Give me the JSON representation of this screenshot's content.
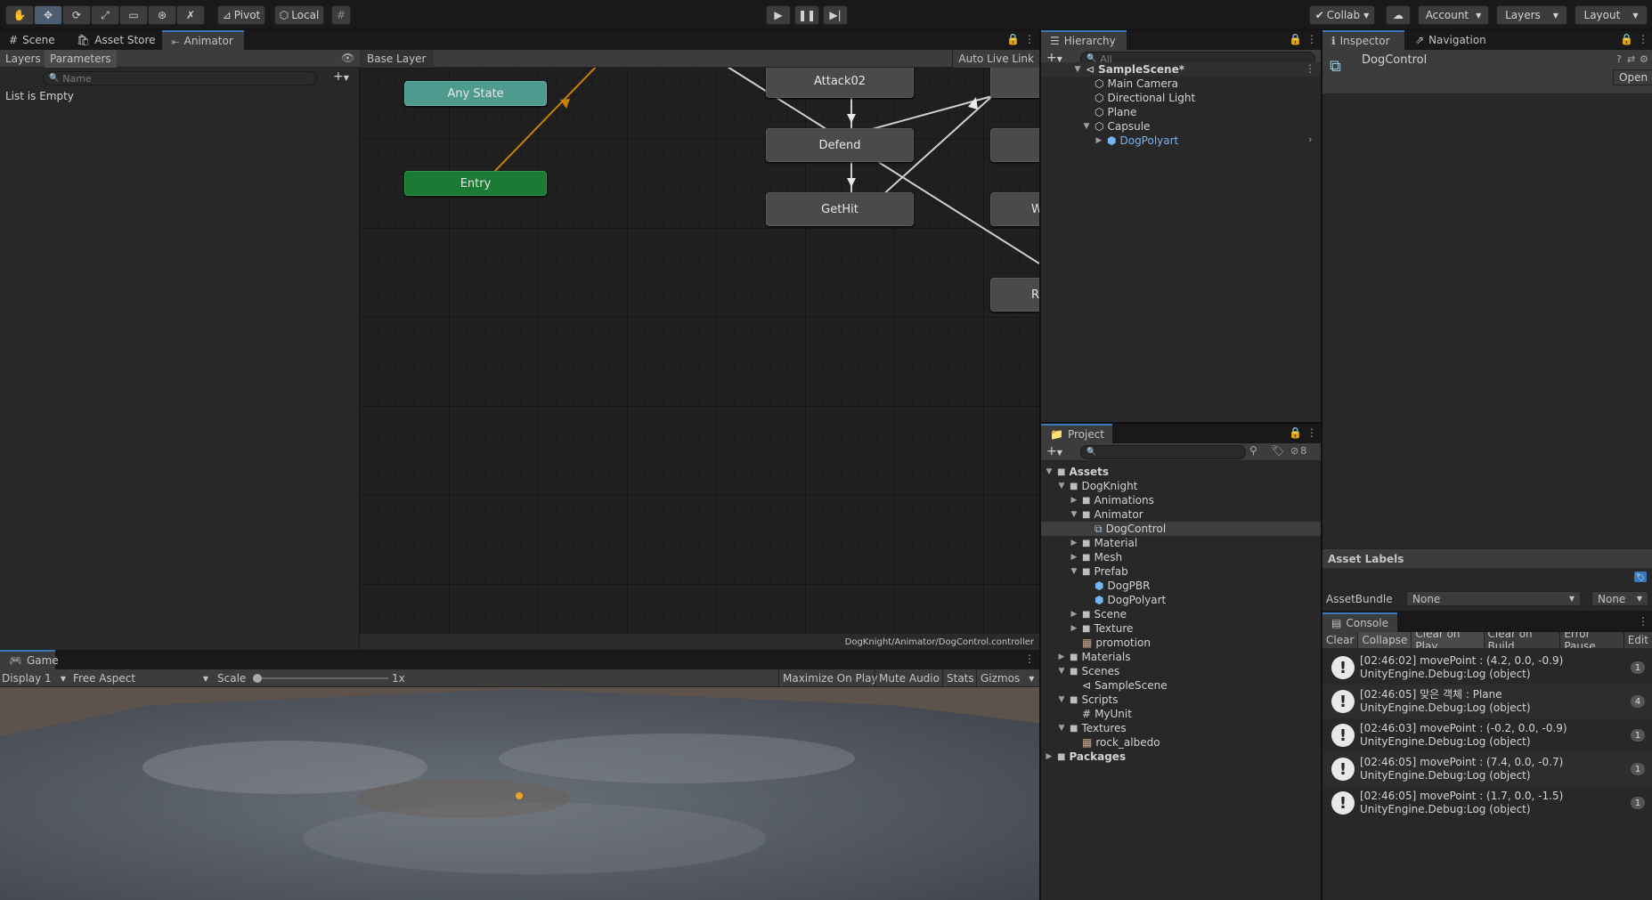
{
  "toolbar": {
    "pivot": "Pivot",
    "local": "Local",
    "collab": "Collab",
    "account": "Account",
    "layers": "Layers",
    "layout": "Layout"
  },
  "scene_tabs": {
    "scene": "Scene",
    "asset_store": "Asset Store",
    "animator": "Animator"
  },
  "animator": {
    "layers_tab": "Layers",
    "parameters_tab": "Parameters",
    "search_placeholder": "Name",
    "list_empty": "List is Empty",
    "base_layer": "Base Layer",
    "auto_live_link": "Auto Live Link",
    "footer_path": "DogKnight/Animator/DogControl.controller",
    "nodes": {
      "any_state": "Any State",
      "entry": "Entry",
      "attack02": "Attack02",
      "defend": "Defend",
      "gethit": "GetHit",
      "partial_w": "W",
      "partial_r": "R"
    }
  },
  "game": {
    "tab": "Game",
    "display": "Display 1",
    "aspect": "Free Aspect",
    "scale_label": "Scale",
    "scale_value": "1x",
    "maximize": "Maximize On Play",
    "mute": "Mute Audio",
    "stats": "Stats",
    "gizmos": "Gizmos"
  },
  "hierarchy": {
    "tab": "Hierarchy",
    "search_placeholder": "All",
    "items": [
      {
        "label": "SampleScene*",
        "depth": 0,
        "expanded": true,
        "bold": true
      },
      {
        "label": "Main Camera",
        "depth": 1
      },
      {
        "label": "Directional Light",
        "depth": 1
      },
      {
        "label": "Plane",
        "depth": 1
      },
      {
        "label": "Capsule",
        "depth": 1,
        "expanded": true
      },
      {
        "label": "DogPolyart",
        "depth": 2,
        "collapsed": true,
        "prefab": true
      }
    ]
  },
  "project": {
    "tab": "Project",
    "hidden_count": "8",
    "items": [
      {
        "label": "Assets",
        "depth": 0,
        "bold": true,
        "expanded": true
      },
      {
        "label": "DogKnight",
        "depth": 1,
        "expanded": true
      },
      {
        "label": "Animations",
        "depth": 2,
        "collapsed": true
      },
      {
        "label": "Animator",
        "depth": 2,
        "expanded": true
      },
      {
        "label": "DogControl",
        "depth": 3,
        "selected": true,
        "kind": "controller"
      },
      {
        "label": "Material",
        "depth": 2,
        "collapsed": true
      },
      {
        "label": "Mesh",
        "depth": 2,
        "collapsed": true
      },
      {
        "label": "Prefab",
        "depth": 2,
        "expanded": true
      },
      {
        "label": "DogPBR",
        "depth": 3,
        "kind": "prefab"
      },
      {
        "label": "DogPolyart",
        "depth": 3,
        "kind": "prefab"
      },
      {
        "label": "Scene",
        "depth": 2,
        "collapsed": true
      },
      {
        "label": "Texture",
        "depth": 2,
        "collapsed": true
      },
      {
        "label": "promotion",
        "depth": 2,
        "kind": "image"
      },
      {
        "label": "Materials",
        "depth": 1,
        "collapsed": true
      },
      {
        "label": "Scenes",
        "depth": 1,
        "expanded": true
      },
      {
        "label": "SampleScene",
        "depth": 2,
        "kind": "scene"
      },
      {
        "label": "Scripts",
        "depth": 1,
        "expanded": true
      },
      {
        "label": "MyUnit",
        "depth": 2,
        "kind": "script"
      },
      {
        "label": "Textures",
        "depth": 1,
        "expanded": true
      },
      {
        "label": "rock_albedo",
        "depth": 2,
        "kind": "image"
      },
      {
        "label": "Packages",
        "depth": 0,
        "bold": true,
        "collapsed": true
      }
    ]
  },
  "inspector": {
    "tab": "Inspector",
    "navigation_tab": "Navigation",
    "object_name": "DogControl",
    "open_button": "Open",
    "asset_labels": "Asset Labels",
    "assetbundle_label": "AssetBundle",
    "assetbundle_value": "None",
    "variant_value": "None"
  },
  "console": {
    "tab": "Console",
    "buttons": [
      "Clear",
      "Collapse",
      "Clear on Play",
      "Clear on Build",
      "Error Pause",
      "Edit"
    ],
    "logs": [
      {
        "line1": "[02:46:02] movePoint : (4.2, 0.0, -0.9)",
        "line2": "UnityEngine.Debug:Log (object)",
        "count": "1"
      },
      {
        "line1": "[02:46:05] 맞은 객체 : Plane",
        "line2": "UnityEngine.Debug:Log (object)",
        "count": "4"
      },
      {
        "line1": "[02:46:03] movePoint : (-0.2, 0.0, -0.9)",
        "line2": "UnityEngine.Debug:Log (object)",
        "count": "1"
      },
      {
        "line1": "[02:46:05] movePoint : (7.4, 0.0, -0.7)",
        "line2": "UnityEngine.Debug:Log (object)",
        "count": "1"
      },
      {
        "line1": "[02:46:05] movePoint : (1.7, 0.0, -1.5)",
        "line2": "UnityEngine.Debug:Log (object)",
        "count": "1"
      }
    ]
  },
  "colors": {
    "accent": "#3a79bb",
    "any_state": "#4f9a8e",
    "entry": "#1b7a34",
    "prefab_blue": "#74b5f2"
  }
}
